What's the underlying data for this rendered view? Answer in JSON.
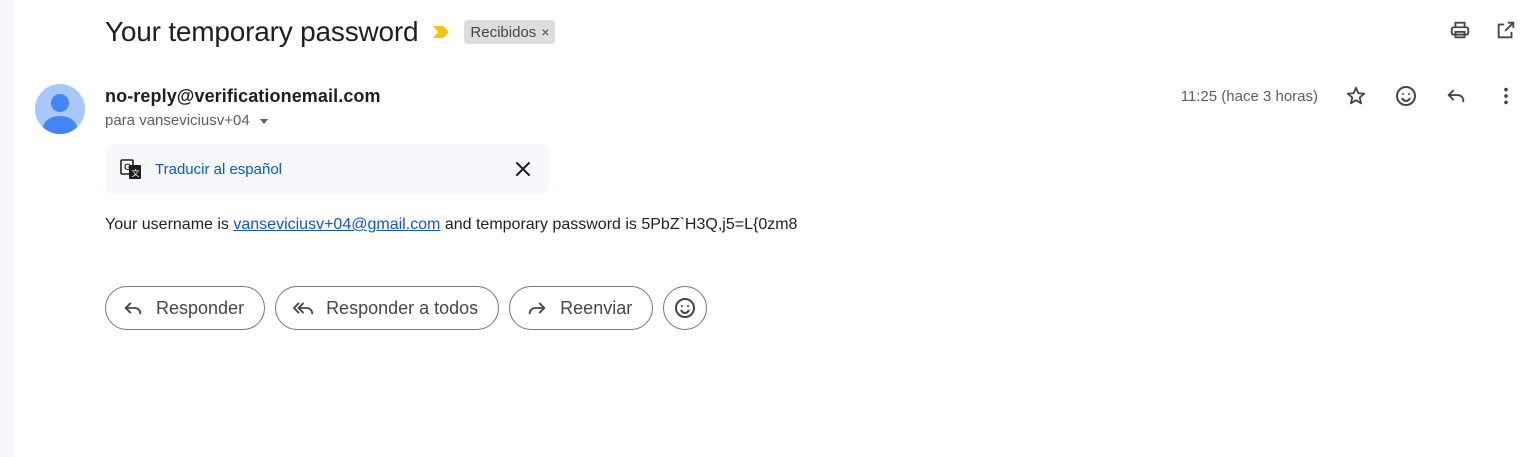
{
  "email": {
    "subject": "Your temporary password",
    "label": "Recibidos",
    "label_remove": "×",
    "sender": "no-reply@verificationemail.com",
    "recipient": "para vanseviciusv+04",
    "timestamp": "11:25 (hace 3 horas)"
  },
  "translate": {
    "link_text": "Traducir al español"
  },
  "body": {
    "prefix": "Your username is",
    "username_link": "vanseviciusv+04@gmail.com",
    "suffix": "and temporary password is 5PbZ`H3Q,j5=L{0zm8"
  },
  "reply_actions": {
    "reply": "Responder",
    "reply_all": "Responder a todos",
    "forward": "Reenviar"
  },
  "icons": {
    "print": "print-icon",
    "open_new_window": "open-in-new-icon",
    "star": "star-icon",
    "emoji": "emoji-icon",
    "reply": "reply-icon",
    "more": "more-vert-icon",
    "translate": "translate-icon",
    "close": "close-icon",
    "reply_all": "reply-all-icon",
    "forward": "forward-icon",
    "importance": "importance-marker-icon",
    "caret": "caret-down-icon"
  },
  "colors": {
    "link": "#0b57d0",
    "importance_marker": "#f4c20d",
    "avatar_bg": "#a8c7fa",
    "avatar_fg": "#4285f4"
  }
}
